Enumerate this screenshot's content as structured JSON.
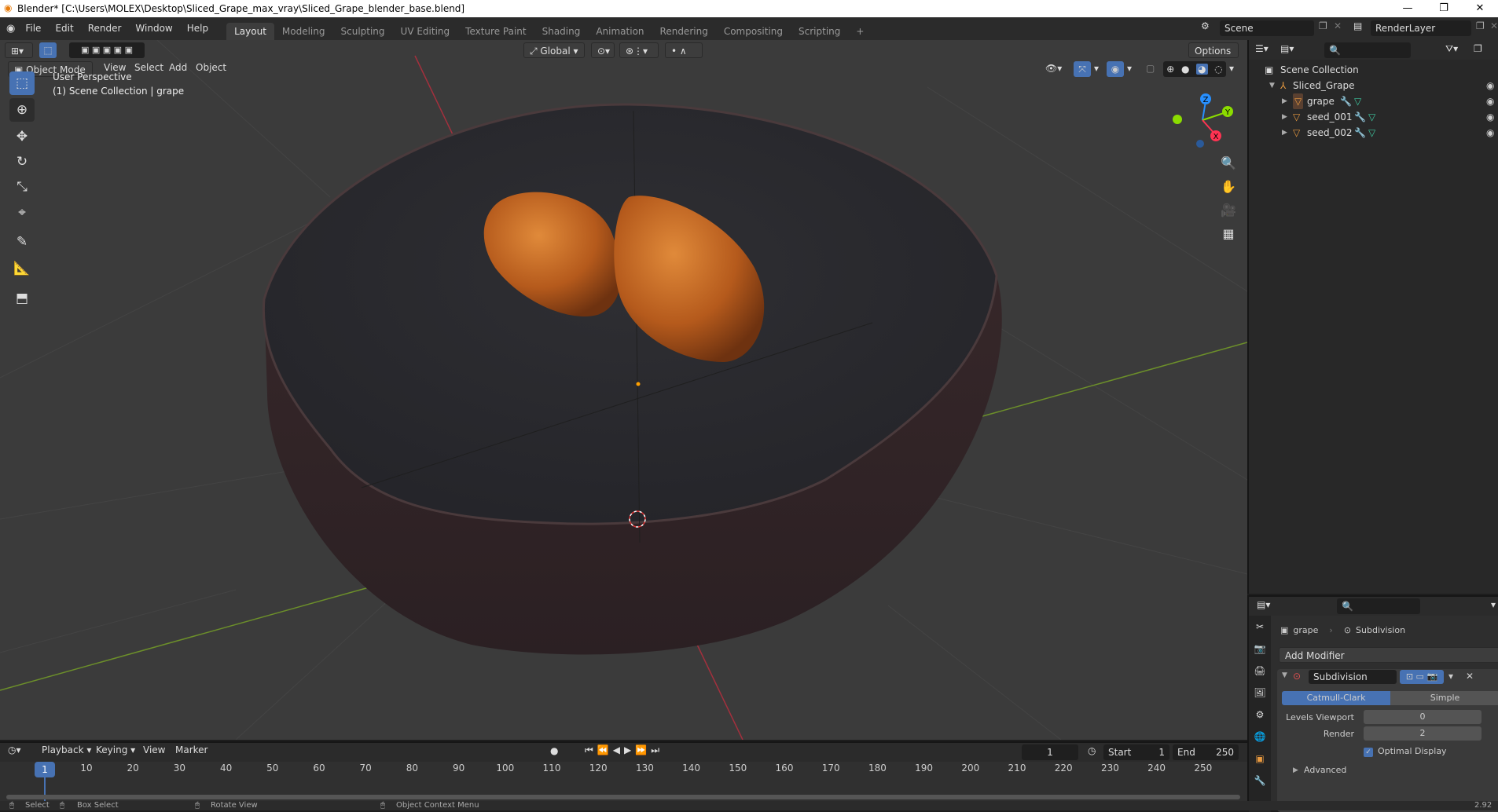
{
  "window": {
    "title": "Blender* [C:\\Users\\MOLEX\\Desktop\\Sliced_Grape_max_vray\\Sliced_Grape_blender_base.blend]",
    "minimize": "—",
    "maximize": "❐",
    "close": "✕"
  },
  "menus": [
    "File",
    "Edit",
    "Render",
    "Window",
    "Help"
  ],
  "workspaces": [
    "Layout",
    "Modeling",
    "Sculpting",
    "UV Editing",
    "Texture Paint",
    "Shading",
    "Animation",
    "Rendering",
    "Compositing",
    "Scripting"
  ],
  "add_workspace": "+",
  "scene": {
    "name": "Scene",
    "render_layer": "RenderLayer"
  },
  "viewport": {
    "orientation": "Global",
    "options_label": "Options",
    "mode": "Object Mode",
    "menu": [
      "View",
      "Select",
      "Add",
      "Object"
    ],
    "info_line1": "User Perspective",
    "info_line2": "(1) Scene Collection | grape",
    "gizmo": {
      "z": "Z",
      "y": "Y",
      "x": "X"
    }
  },
  "toolbar": [
    "select-box",
    "cursor",
    "move",
    "rotate",
    "scale",
    "transform",
    "annotate",
    "measure",
    "add-cube"
  ],
  "outliner": {
    "root": "Scene Collection",
    "collection": "Sliced_Grape",
    "objects": [
      "grape",
      "seed_001",
      "seed_002"
    ]
  },
  "properties": {
    "object": "grape",
    "modifier_crumb": "Subdivision",
    "add_modifier": "Add Modifier",
    "modifier_name": "Subdivision",
    "type_catmull": "Catmull-Clark",
    "type_simple": "Simple",
    "levels_viewport_label": "Levels Viewport",
    "levels_viewport_value": "0",
    "render_label": "Render",
    "render_value": "2",
    "optimal_display": "Optimal Display",
    "advanced": "Advanced"
  },
  "timeline": {
    "menu": [
      "Playback",
      "Keying",
      "View",
      "Marker"
    ],
    "current_frame": "1",
    "start_label": "Start",
    "start_value": "1",
    "end_label": "End",
    "end_value": "250",
    "ticks": [
      "1",
      "10",
      "20",
      "30",
      "40",
      "50",
      "60",
      "70",
      "80",
      "90",
      "100",
      "110",
      "120",
      "130",
      "140",
      "150",
      "160",
      "170",
      "180",
      "190",
      "200",
      "210",
      "220",
      "230",
      "240",
      "250"
    ]
  },
  "status": {
    "select": "Select",
    "box_select": "Box Select",
    "rotate_view": "Rotate View",
    "context_menu": "Object Context Menu",
    "version": "2.92"
  },
  "colors": {
    "accent": "#4772b3",
    "viewport_bg": "#3b3b3b",
    "x_axis": "#ff3352",
    "y_axis": "#8bdc00",
    "z_axis": "#2890ff",
    "seed": "#c4651f",
    "grape_skin": "#3a2a2a"
  }
}
